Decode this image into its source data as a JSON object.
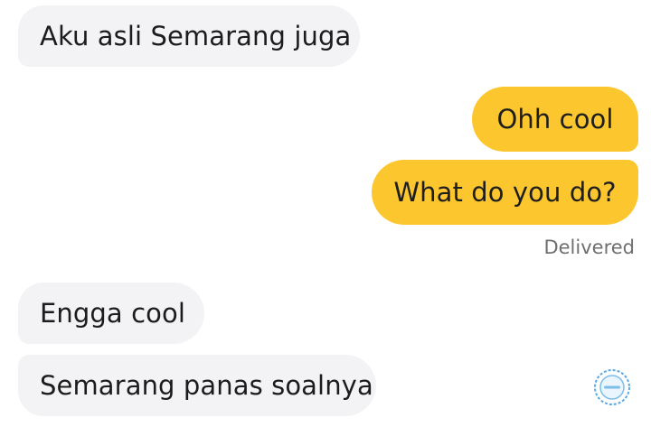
{
  "conversation": {
    "messages": [
      {
        "side": "incoming",
        "text": "Aku asli Semarang juga"
      },
      {
        "side": "outgoing",
        "text": "Ohh cool"
      },
      {
        "side": "outgoing",
        "text": "What do you do?"
      },
      {
        "side": "incoming",
        "text": "Engga cool"
      },
      {
        "side": "incoming",
        "text": "Semarang panas soalnya"
      }
    ],
    "status": "Delivered"
  },
  "colors": {
    "incoming_bubble": "#f3f3f5",
    "outgoing_bubble": "#fcc62e",
    "text": "#1c1c1c",
    "status_text": "#6f6f6f"
  },
  "watermark": {
    "icon": "watermark-badge-icon"
  }
}
